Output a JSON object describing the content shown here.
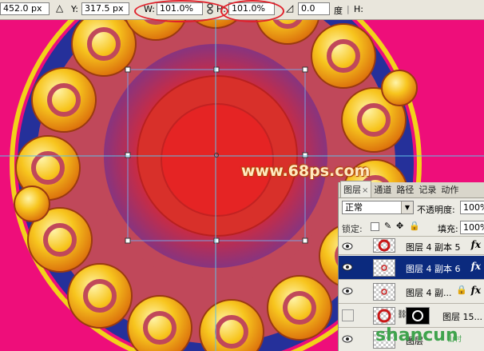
{
  "options_bar": {
    "x_value": "452.0 px",
    "y_label": "Y:",
    "y_value": "317.5 px",
    "w_label": "W:",
    "w_value": "101.0%",
    "h_label": "H:",
    "h_value": "101.0%",
    "angle_value": "0.0",
    "angle_unit": "度",
    "hskew_label": "H:"
  },
  "canvas": {
    "watermark": "www.68ps.com",
    "colors": {
      "background": "#ee0e7a",
      "gold": "#f7c51e",
      "red": "#e21a1a",
      "blue": "#2a3aa8"
    }
  },
  "layers_panel": {
    "tabs": [
      "图层",
      "通道",
      "路径",
      "记录",
      "动作"
    ],
    "active_tab": "图层",
    "tab_close": "×",
    "blend_mode": "正常",
    "opacity_label": "不透明度:",
    "opacity_value": "100%",
    "lock_label": "锁定:",
    "fill_label": "填充:",
    "fill_value": "100%",
    "layers": [
      {
        "name": "图层 4 副本 5",
        "fx": "fx"
      },
      {
        "name": "图层 4 副本 6",
        "fx": "fx"
      },
      {
        "name": "图层 4 副...",
        "fx": "fx"
      },
      {
        "name": "图层 15..."
      },
      {
        "name": "图层"
      }
    ]
  },
  "brand": {
    "main": "shancun",
    "sub": "山村"
  }
}
